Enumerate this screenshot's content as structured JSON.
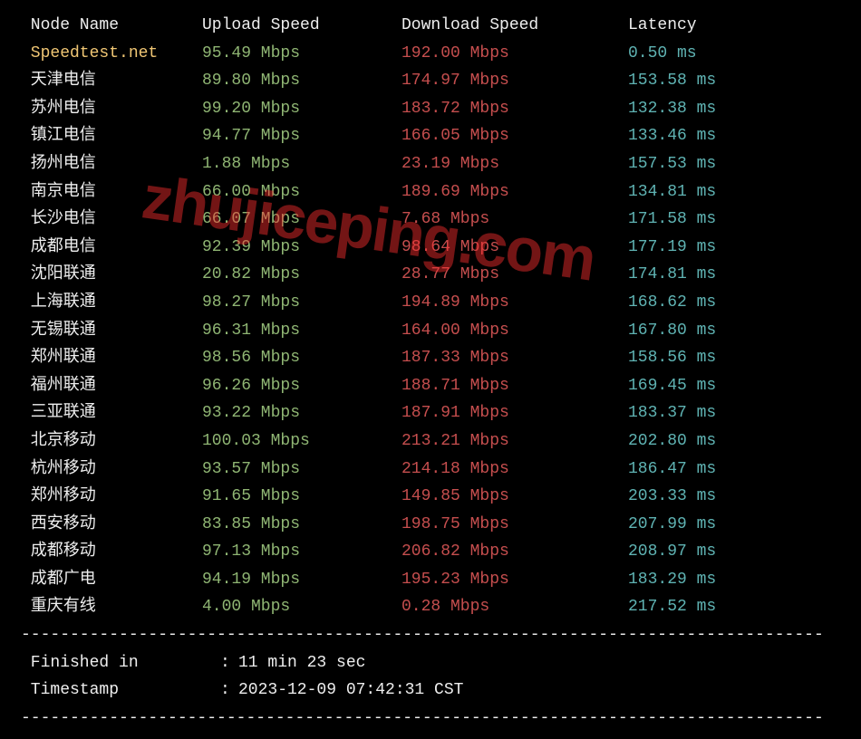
{
  "header": {
    "node": " Node Name",
    "upload": "Upload Speed",
    "download": "Download Speed",
    "latency": "Latency"
  },
  "first": {
    "node": " Speedtest.net",
    "upload": "95.49 Mbps",
    "download": "192.00 Mbps",
    "latency": "0.50 ms"
  },
  "rows": [
    {
      "node": " 天津电信",
      "upload": "89.80 Mbps",
      "download": "174.97 Mbps",
      "latency": "153.58 ms"
    },
    {
      "node": " 苏州电信",
      "upload": "99.20 Mbps",
      "download": "183.72 Mbps",
      "latency": "132.38 ms"
    },
    {
      "node": " 镇江电信",
      "upload": "94.77 Mbps",
      "download": "166.05 Mbps",
      "latency": "133.46 ms"
    },
    {
      "node": " 扬州电信",
      "upload": "1.88 Mbps",
      "download": "23.19 Mbps",
      "latency": "157.53 ms"
    },
    {
      "node": " 南京电信",
      "upload": "66.00 Mbps",
      "download": "189.69 Mbps",
      "latency": "134.81 ms"
    },
    {
      "node": " 长沙电信",
      "upload": "66.07 Mbps",
      "download": "7.68 Mbps",
      "latency": "171.58 ms"
    },
    {
      "node": " 成都电信",
      "upload": "92.39 Mbps",
      "download": "98.64 Mbps",
      "latency": "177.19 ms"
    },
    {
      "node": " 沈阳联通",
      "upload": "20.82 Mbps",
      "download": "28.77 Mbps",
      "latency": "174.81 ms"
    },
    {
      "node": " 上海联通",
      "upload": "98.27 Mbps",
      "download": "194.89 Mbps",
      "latency": "168.62 ms"
    },
    {
      "node": " 无锡联通",
      "upload": "96.31 Mbps",
      "download": "164.00 Mbps",
      "latency": "167.80 ms"
    },
    {
      "node": " 郑州联通",
      "upload": "98.56 Mbps",
      "download": "187.33 Mbps",
      "latency": "158.56 ms"
    },
    {
      "node": " 福州联通",
      "upload": "96.26 Mbps",
      "download": "188.71 Mbps",
      "latency": "169.45 ms"
    },
    {
      "node": " 三亚联通",
      "upload": "93.22 Mbps",
      "download": "187.91 Mbps",
      "latency": "183.37 ms"
    },
    {
      "node": " 北京移动",
      "upload": "100.03 Mbps",
      "download": "213.21 Mbps",
      "latency": "202.80 ms"
    },
    {
      "node": " 杭州移动",
      "upload": "93.57 Mbps",
      "download": "214.18 Mbps",
      "latency": "186.47 ms"
    },
    {
      "node": " 郑州移动",
      "upload": "91.65 Mbps",
      "download": "149.85 Mbps",
      "latency": "203.33 ms"
    },
    {
      "node": " 西安移动",
      "upload": "83.85 Mbps",
      "download": "198.75 Mbps",
      "latency": "207.99 ms"
    },
    {
      "node": " 成都移动",
      "upload": "97.13 Mbps",
      "download": "206.82 Mbps",
      "latency": "208.97 ms"
    },
    {
      "node": " 成都广电",
      "upload": "94.19 Mbps",
      "download": "195.23 Mbps",
      "latency": "183.29 ms"
    },
    {
      "node": " 重庆有线",
      "upload": "4.00 Mbps",
      "download": "0.28 Mbps",
      "latency": "217.52 ms"
    }
  ],
  "divider": "----------------------------------------------------------------------------------",
  "footer": {
    "finished_label": " Finished in",
    "finished_value": "11 min 23 sec",
    "timestamp_label": " Timestamp",
    "timestamp_value": "2023-12-09 07:42:31 CST",
    "colon": ": "
  },
  "watermark": "zhujiceping.com"
}
